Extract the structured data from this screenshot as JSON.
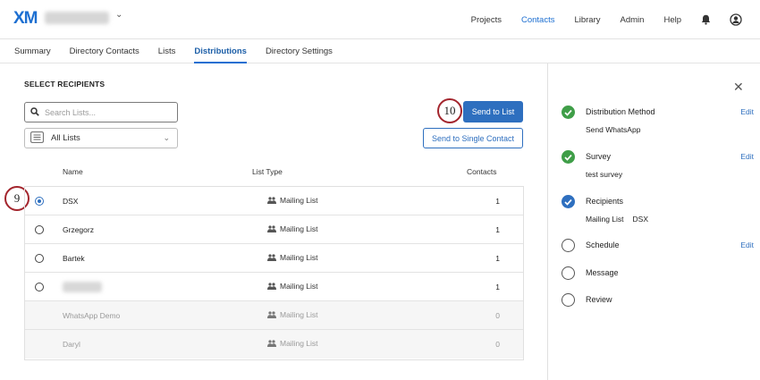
{
  "topbar": {
    "logo": "XM",
    "nav": [
      "Projects",
      "Contacts",
      "Library",
      "Admin",
      "Help"
    ],
    "active_nav": "Contacts"
  },
  "subnav": {
    "tabs": [
      "Summary",
      "Directory Contacts",
      "Lists",
      "Distributions",
      "Directory Settings"
    ],
    "active_tab": "Distributions"
  },
  "main": {
    "section_title": "SELECT RECIPIENTS",
    "search_placeholder": "Search Lists...",
    "filter_value": "All Lists",
    "send_to_list": "Send to List",
    "send_to_single": "Send to Single Contact",
    "callouts": {
      "send": "10",
      "radio": "9"
    },
    "table": {
      "headers": {
        "name": "Name",
        "type": "List Type",
        "contacts": "Contacts"
      },
      "rows": [
        {
          "name": "DSX",
          "type": "Mailing List",
          "contacts": "1"
        },
        {
          "name": "Grzegorz",
          "type": "Mailing List",
          "contacts": "1"
        },
        {
          "name": "Bartek",
          "type": "Mailing List",
          "contacts": "1"
        },
        {
          "name": "",
          "type": "Mailing List",
          "contacts": "1"
        },
        {
          "name": "WhatsApp Demo",
          "type": "Mailing List",
          "contacts": "0"
        },
        {
          "name": "Daryl",
          "type": "Mailing List",
          "contacts": "0"
        }
      ]
    }
  },
  "side_panel": {
    "steps": [
      {
        "label": "Distribution Method",
        "sub": "Send WhatsApp",
        "edit": "Edit",
        "status": "done"
      },
      {
        "label": "Survey",
        "sub": "test survey",
        "edit": "Edit",
        "status": "done"
      },
      {
        "label": "Recipients",
        "sub_a": "Mailing List",
        "sub_b": "DSX",
        "status": "current"
      },
      {
        "label": "Schedule",
        "edit": "Edit",
        "status": "todo"
      },
      {
        "label": "Message",
        "status": "todo"
      },
      {
        "label": "Review",
        "status": "todo"
      }
    ]
  },
  "colors": {
    "accent": "#2e6fbf",
    "done": "#3f9e48",
    "callout": "#a3252d"
  }
}
